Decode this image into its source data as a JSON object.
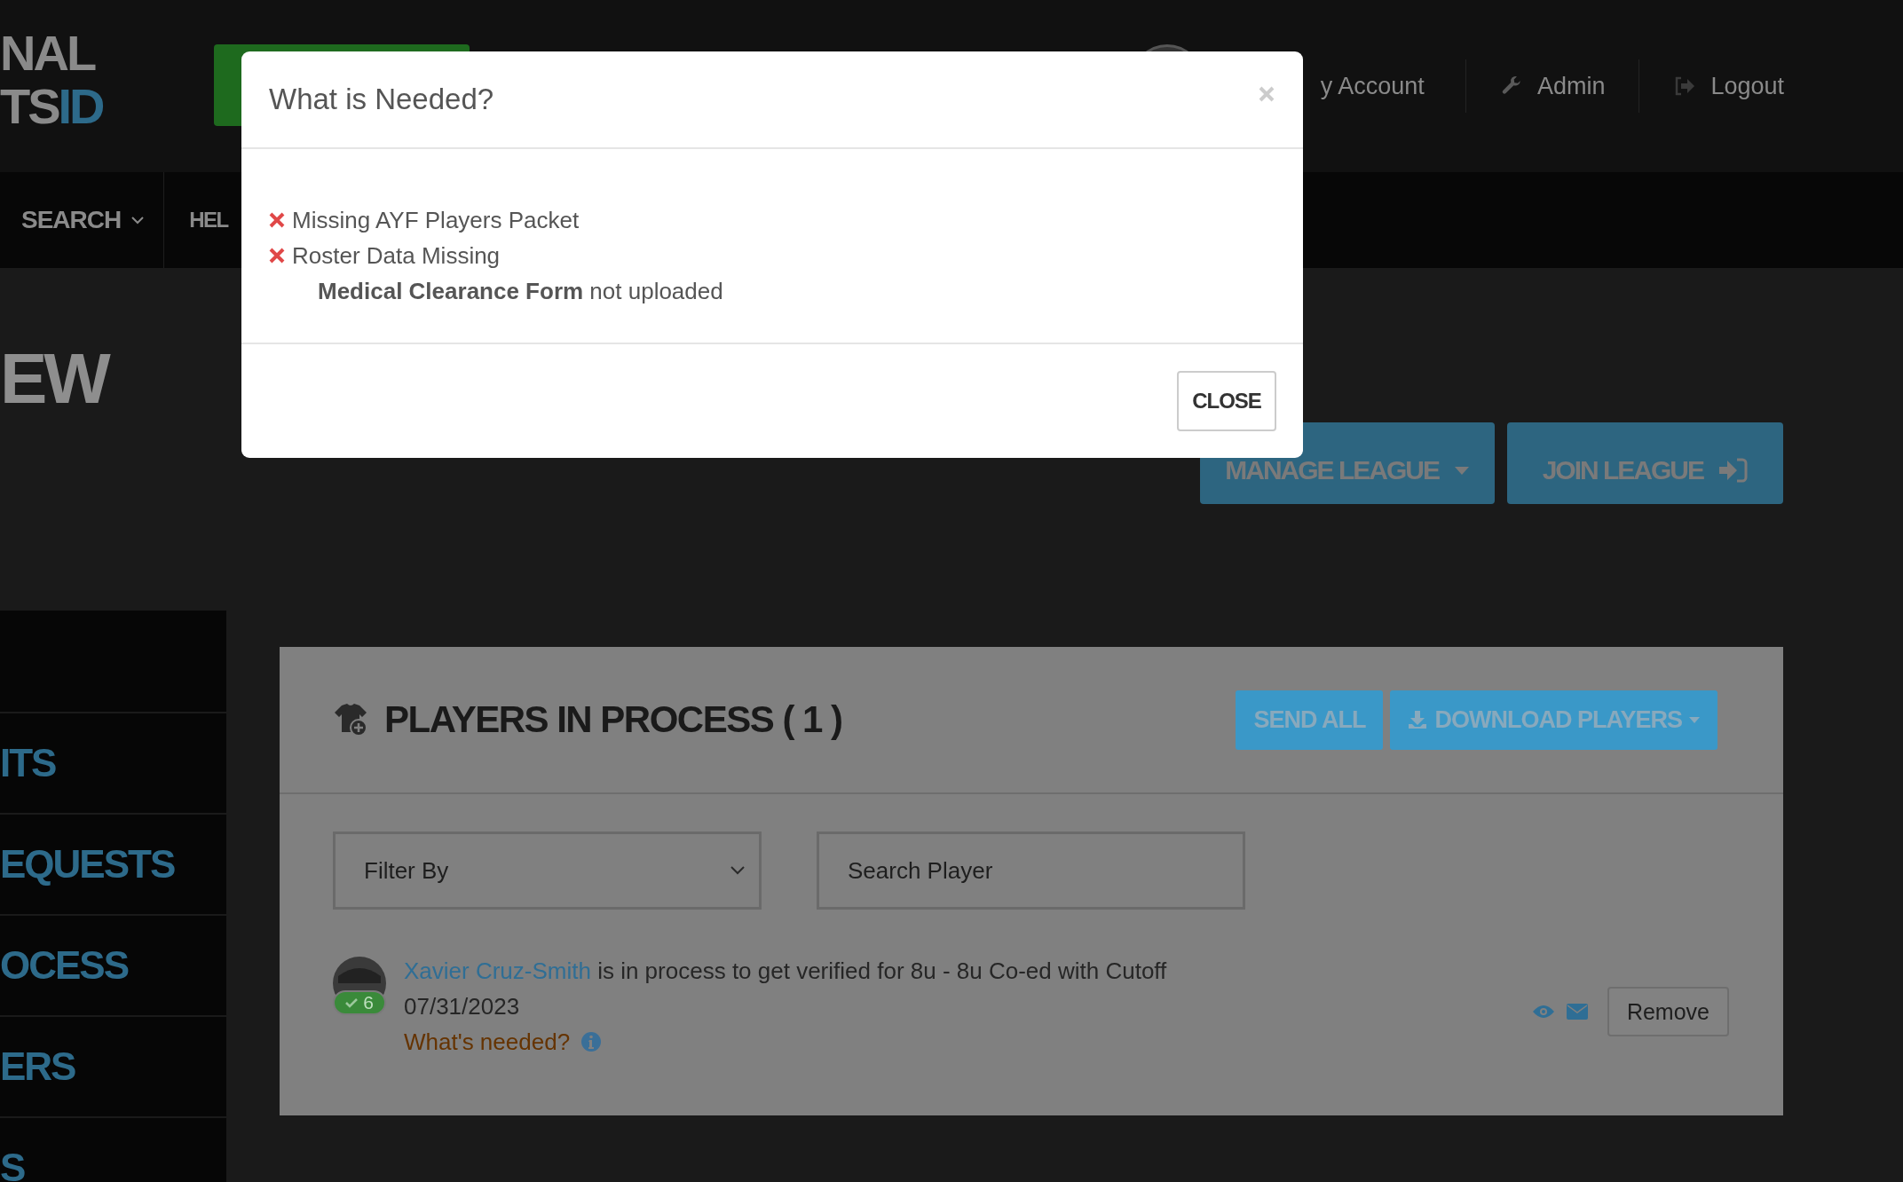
{
  "header": {
    "logo": {
      "top": "NAL",
      "bottom": "TS",
      "bottom_accent": "ID"
    },
    "user_links": [
      {
        "label": "y Account"
      },
      {
        "label": "Admin"
      },
      {
        "label": "Logout"
      }
    ]
  },
  "nav": [
    {
      "label": "SEARCH"
    },
    {
      "label": "HEL"
    }
  ],
  "page_title": "EW",
  "actions": [
    {
      "label": "MANAGE LEAGUE"
    },
    {
      "label": "JOIN LEAGUE"
    }
  ],
  "sidebar": {
    "items": [
      "ITS",
      "EQUESTS",
      "OCESS",
      "ERS",
      "S"
    ]
  },
  "panel": {
    "title": "PLAYERS IN PROCESS ( 1 )",
    "buttons": [
      {
        "label": "SEND ALL"
      },
      {
        "label": "DOWNLOAD PLAYERS"
      }
    ],
    "filter": {
      "value": "Filter By"
    },
    "search": {
      "placeholder": "Search Player"
    },
    "players": [
      {
        "name": "Xavier Cruz-Smith",
        "text": "is in process to get verified for 8u - 8u Co-ed with Cutoff",
        "date": "07/31/2023",
        "badge": "6",
        "needed_link": "What's needed?",
        "remove": "Remove"
      }
    ]
  },
  "modal": {
    "title": "What is Needed?",
    "items": [
      {
        "kind": "missing",
        "text": "Missing AYF Players Packet"
      },
      {
        "kind": "missing",
        "text": "Roster Data Missing"
      },
      {
        "kind": "detail",
        "text": "**Medical Clearance Form** not uploaded"
      }
    ],
    "close_button": "CLOSE"
  }
}
